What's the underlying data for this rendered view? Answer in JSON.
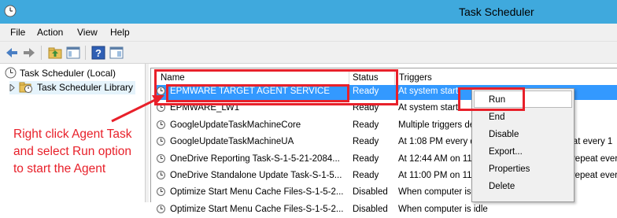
{
  "window": {
    "title": "Task Scheduler"
  },
  "menu": [
    "File",
    "Action",
    "View",
    "Help"
  ],
  "toolbar": {
    "icons": [
      "back-arrow-icon",
      "forward-arrow-icon",
      "folder-up-icon",
      "show-hide-tree-icon",
      "help-icon",
      "show-hide-action-pane-icon"
    ]
  },
  "tree": {
    "root": "Task Scheduler (Local)",
    "library": "Task Scheduler Library"
  },
  "table": {
    "headers": {
      "name": "Name",
      "status": "Status",
      "triggers": "Triggers"
    },
    "rows": [
      {
        "name": "EPMWARE TARGET AGENT SERVICE",
        "status": "Ready",
        "trigger": "At system start",
        "selected": true
      },
      {
        "name": "EPMWARE_LW1",
        "status": "Ready",
        "trigger": "At system start",
        "selected": false
      },
      {
        "name": "GoogleUpdateTaskMachineCore",
        "status": "Ready",
        "trigger": "Multiple triggers defined",
        "selected": false
      },
      {
        "name": "GoogleUpdateTaskMachineUA",
        "status": "Ready",
        "trigger": "At 1:08 PM every day - After triggered, repeat every 1",
        "selected": false
      },
      {
        "name": "OneDrive Reporting Task-S-1-5-21-2084...",
        "status": "Ready",
        "trigger": "At 12:44 AM on 11/8/2021 - After triggered, repeat every",
        "selected": false
      },
      {
        "name": "OneDrive Standalone Update Task-S-1-5...",
        "status": "Ready",
        "trigger": "At 11:00 PM on 11/8/2021 - After triggered, repeat every",
        "selected": false
      },
      {
        "name": "Optimize Start Menu Cache Files-S-1-5-2...",
        "status": "Disabled",
        "trigger": "When computer is idle",
        "selected": false
      },
      {
        "name": "Optimize Start Menu Cache Files-S-1-5-2...",
        "status": "Disabled",
        "trigger": "When computer is idle",
        "selected": false
      }
    ]
  },
  "context_menu": {
    "items": [
      "Run",
      "End",
      "Disable",
      "Export...",
      "Properties",
      "Delete"
    ]
  },
  "annotation": {
    "text": "Right click Agent Task and select Run option to start the Agent",
    "color": "#e8202a"
  },
  "colors": {
    "titlebar": "#3fa9dd",
    "selection": "#3399ff",
    "annotation": "#e8202a"
  }
}
